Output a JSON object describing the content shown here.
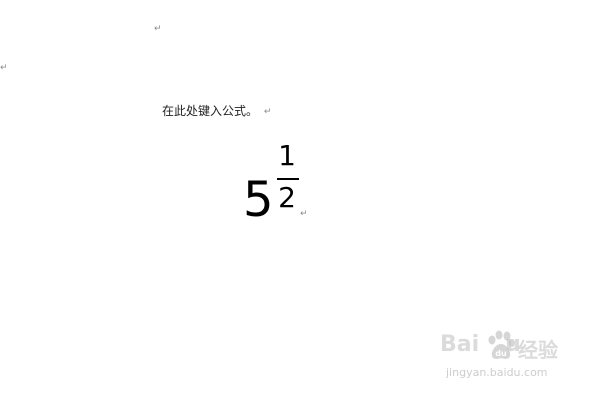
{
  "document": {
    "paragraph_mark": "↵",
    "prompt_text": "在此处键入公式。"
  },
  "equation": {
    "base": "5",
    "exponent_numerator": "1",
    "exponent_denominator": "2"
  },
  "watermark": {
    "logo_text": "Bai",
    "logo_suffix": "u",
    "brand_text": "经验",
    "url_text": "jingyan.baidu.com",
    "paw_icon": "baidu-paw-icon"
  }
}
